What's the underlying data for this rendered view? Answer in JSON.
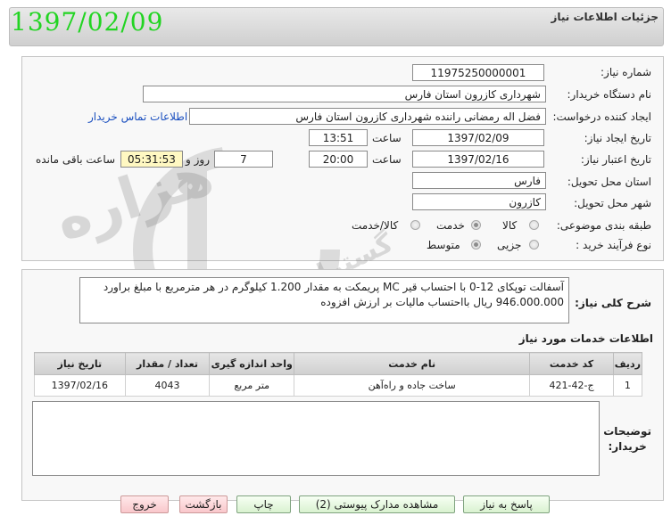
{
  "header": {
    "title": "جزئیات اطلاعات نیاز",
    "date_stamp": "1397/02/09"
  },
  "form": {
    "need_number_label": "شماره نیاز:",
    "need_number": "11975250000001",
    "buyer_org_label": "نام دستگاه خریدار:",
    "buyer_org": "شهرداری کازرون استان فارس",
    "requester_label": "ایجاد کننده درخواست:",
    "requester": "فضل اله رمضانی راننده شهرداری کازرون استان فارس",
    "contact_link": "اطلاعات تماس خریدار",
    "create_date_label": "تاریخ ایجاد نیاز:",
    "create_date": "1397/02/09",
    "time_label": "ساعت",
    "create_time": "13:51",
    "validity_label": "تاریخ اعتبار نیاز:",
    "validity_date": "1397/02/16",
    "validity_time": "20:00",
    "days_label": "روز و",
    "days": "7",
    "remaining_time": "05:31:53",
    "remaining_label": "ساعت باقی مانده",
    "province_label": "استان محل تحویل:",
    "province": "فارس",
    "city_label": "شهر محل تحویل:",
    "city": "کازرون",
    "category_label": "طبقه بندی موضوعی:",
    "category_options": [
      "کالا",
      "خدمت",
      "کالا/خدمت"
    ],
    "category_selected": "خدمت",
    "process_label": "نوع فرآیند خرید :",
    "process_options": [
      "جزیی",
      "متوسط"
    ],
    "process_selected": "متوسط"
  },
  "description": {
    "label": "شرح کلی نیاز:",
    "line1": "آسفالت توپکای 12-0  با احتساب قیر MC پریمکت به مقدار 1.200 کیلوگرم در هر مترمربع با مبلغ براورد",
    "line2": "946.000.000 ریال بااحتساب مالیات بر ارزش افزوده"
  },
  "services": {
    "title": "اطلاعات خدمات مورد نیاز",
    "columns": [
      "ردیف",
      "کد خدمت",
      "نام خدمت",
      "واحد اندازه گیری",
      "تعداد / مقدار",
      "تاریخ نیاز"
    ],
    "rows": [
      [
        "1",
        "ج-42-421",
        "ساخت جاده و راه‌آهن",
        "متر مربع",
        "4043",
        "1397/02/16"
      ]
    ]
  },
  "buyer_notes": {
    "label_line1": "توضیحات",
    "label_line2": "خریدار:",
    "value": ""
  },
  "buttons": {
    "reply": "پاسخ به نیاز",
    "attachments": "مشاهده مدارک پیوستی (2)",
    "print": "چاپ",
    "back": "بازگشت",
    "exit": "خروج"
  },
  "watermark": {
    "line1": "هزاره",
    "line2": "گستران ارتباط"
  },
  "colors": {
    "date_stamp": "#22d422",
    "link": "#1a4fbf",
    "button_green": "#d9f2d0",
    "button_red": "#f9c7cb",
    "highlight_yellow": "#fff8c2"
  }
}
